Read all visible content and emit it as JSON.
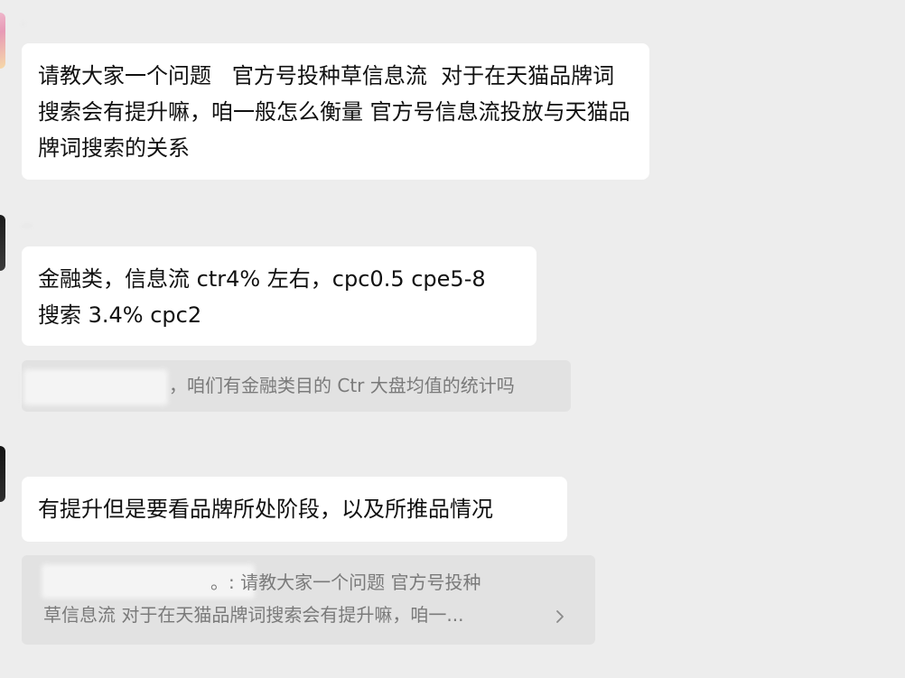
{
  "chat": {
    "messages": [
      {
        "sender": ".",
        "text": "请教大家一个问题   官方号投种草信息流  对于在天猫品牌词搜索会有提升嘛，咱一般怎么衡量 官方号信息流投放与天猫品牌词搜索的关系"
      },
      {
        "sender": "...",
        "text": "金融类，信息流 ctr4% 左右，cpc0.5 cpe5-8\n搜索 3.4% cpc2",
        "quote": {
          "text": "，咱们有金融类目的 Ctr 大盘均值的统计吗"
        }
      },
      {
        "sender": "",
        "text": "有提升但是要看品牌所处阶段，以及所推品情况",
        "quote": {
          "line1": "。: 请教大家一个问题   官方号投种",
          "line2": "草信息流  对于在天猫品牌词搜索会有提升嘛，咱一..."
        }
      }
    ]
  },
  "icons": {
    "quote_expand": "chevron-right-icon"
  },
  "colors": {
    "background": "#ededed",
    "bubble": "#ffffff",
    "quote_background": "#e2e2e2",
    "quote_text": "#7a7a7a"
  }
}
